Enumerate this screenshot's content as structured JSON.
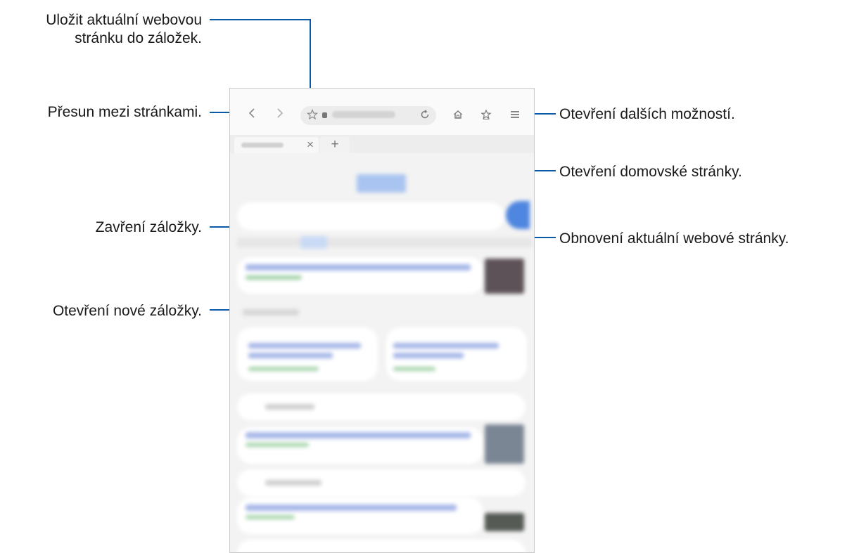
{
  "annotations": {
    "bookmark_current": "Uložit aktuální webovou\nstránku do záložek.",
    "navigate_pages": "Přesun mezi stránkami.",
    "close_tab": "Zavření záložky.",
    "new_tab": "Otevření nové záložky.",
    "more_options": "Otevření dalších možností.",
    "home_page": "Otevření domovské stránky.",
    "refresh_page": "Obnovení aktuální webové stránky."
  },
  "browser": {
    "back_icon": "chevron-left-icon",
    "forward_icon": "chevron-right-icon",
    "bookmark_icon": "star-icon",
    "refresh_icon": "refresh-icon",
    "home_icon": "home-icon",
    "bookmarks_icon": "bookmarks-icon",
    "menu_icon": "menu-icon",
    "close_tab_glyph": "×",
    "new_tab_glyph": "+"
  },
  "colors": {
    "leader": "#0a5aa8",
    "highlight": "#0a5aa8"
  }
}
